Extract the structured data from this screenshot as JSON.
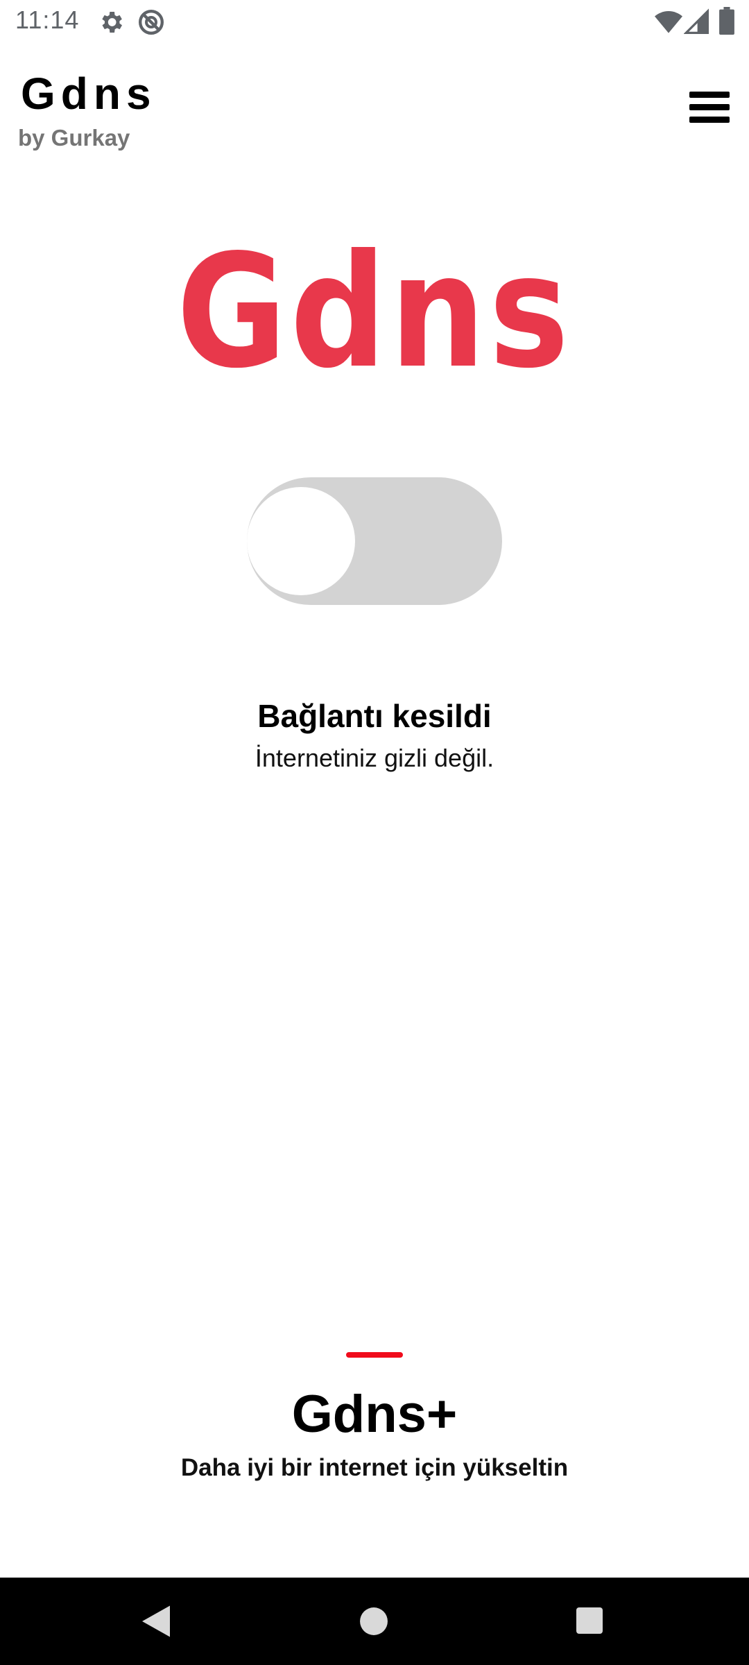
{
  "status_bar": {
    "time": "11:14",
    "icons": [
      "gear-icon",
      "do-not-disturb-icon",
      "wifi-icon",
      "signal-icon",
      "battery-icon"
    ]
  },
  "header": {
    "title": "Gdns",
    "subtitle": "by Gurkay",
    "menu_icon": "hamburger-menu-icon"
  },
  "logo": {
    "text": "Gdns",
    "color": "#e8384b"
  },
  "toggle": {
    "state": "off",
    "track_color": "#d3d3d3"
  },
  "connection": {
    "title": "Bağlantı kesildi",
    "subtitle": "İnternetiniz gizli değil."
  },
  "upgrade": {
    "accent_color": "#f00c1c",
    "title": "Gdns+",
    "subtitle": "Daha iyi bir internet için yükseltin"
  },
  "nav_bar": {
    "buttons": [
      "back-icon",
      "home-icon",
      "recents-icon"
    ]
  }
}
